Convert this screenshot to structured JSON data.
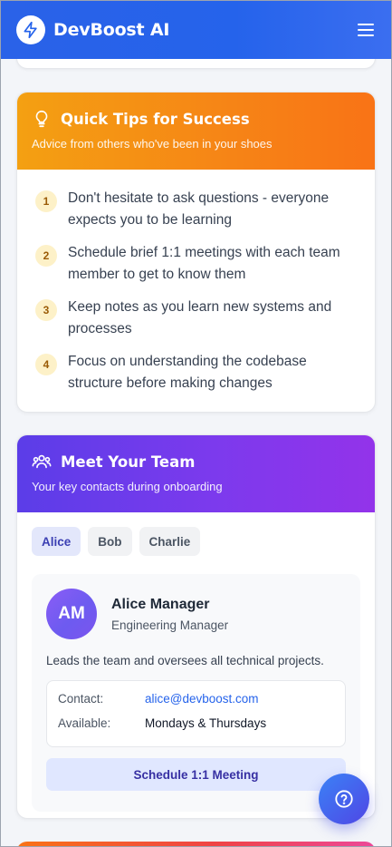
{
  "app": {
    "brand": "DevBoost AI"
  },
  "tips": {
    "title": "Quick Tips for Success",
    "subtitle": "Advice from others who've been in your shoes",
    "items": [
      {
        "num": "1",
        "text": "Don't hesitate to ask questions - everyone expects you to be learning"
      },
      {
        "num": "2",
        "text": "Schedule brief 1:1 meetings with each team member to get to know them"
      },
      {
        "num": "3",
        "text": "Keep notes as you learn new systems and processes"
      },
      {
        "num": "4",
        "text": "Focus on understanding the codebase structure before making changes"
      }
    ]
  },
  "team": {
    "title": "Meet Your Team",
    "subtitle": "Your key contacts during onboarding",
    "tabs": [
      "Alice",
      "Bob",
      "Charlie"
    ],
    "selected_tab": "Alice",
    "member": {
      "initials": "AM",
      "name": "Alice Manager",
      "role": "Engineering Manager",
      "description": "Leads the team and oversees all technical projects.",
      "contact_label": "Contact:",
      "contact_value": "alice@devboost.com",
      "available_label": "Available:",
      "available_value": "Mondays & Thursdays",
      "button_label": "Schedule 1:1 Meeting"
    }
  },
  "colors": {
    "header": "#2563eb",
    "tips_accent": "#f68416",
    "team_accent": "#7c3aed",
    "link": "#2563eb"
  },
  "icons": {
    "logo": "lightning-bolt-icon",
    "menu": "hamburger-menu-icon",
    "tips": "lightbulb-icon",
    "team": "users-icon",
    "help": "question-mark-icon"
  }
}
